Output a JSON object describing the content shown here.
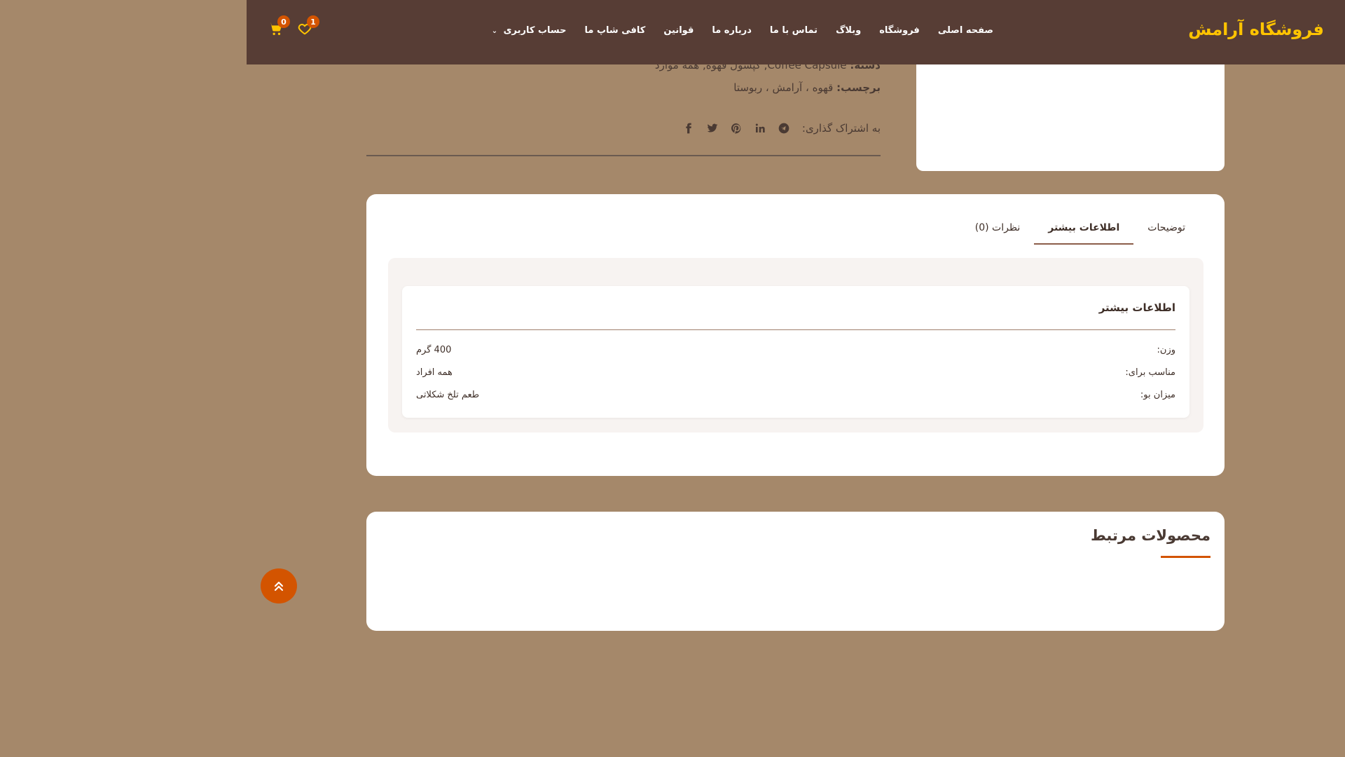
{
  "header": {
    "logo": "فروشگاه آرامش",
    "nav": [
      {
        "label": "صفحه اصلی"
      },
      {
        "label": "فروشگاه"
      },
      {
        "label": "وبلاگ"
      },
      {
        "label": "تماس با ما"
      },
      {
        "label": "درباره ما"
      },
      {
        "label": "قوانین"
      },
      {
        "label": "کافی شاپ ما"
      },
      {
        "label": "حساب کاربری"
      }
    ],
    "cart_count": "0",
    "wishlist_count": "1",
    "colors": {
      "background": "#573d35",
      "logo": "#ffc400",
      "badge": "#d35400"
    }
  },
  "product_meta": {
    "category_label": "دسته:",
    "category_value": "Coffee Capsule, کپسول قهوه, همه موارد",
    "tags_label": "برچسب:",
    "tags_value": "قهوه ، آرامش ، ربوستا",
    "share_label": "به اشتراک گذاری:",
    "share_icons": [
      "telegram-icon",
      "linkedin-icon",
      "pinterest-icon",
      "twitter-icon",
      "facebook-icon"
    ]
  },
  "tabs": {
    "items": [
      {
        "label": "توضیحات"
      },
      {
        "label": "اطلاعات بیشتر"
      },
      {
        "label": "نظرات (0)"
      }
    ],
    "active": "اطلاعات بیشتر",
    "panel": {
      "title": "اطلاعات بیشتر",
      "rows": [
        {
          "label": "وزن:",
          "value": "400 گرم"
        },
        {
          "label": "مناسب برای:",
          "value": "همه افراد"
        },
        {
          "label": "میزان بو:",
          "value": "طعم تلخ شکلاتی"
        }
      ]
    }
  },
  "related": {
    "title": "محصولات مرتبط"
  },
  "colors": {
    "page_background": "#a5886a",
    "accent": "#d35400"
  }
}
